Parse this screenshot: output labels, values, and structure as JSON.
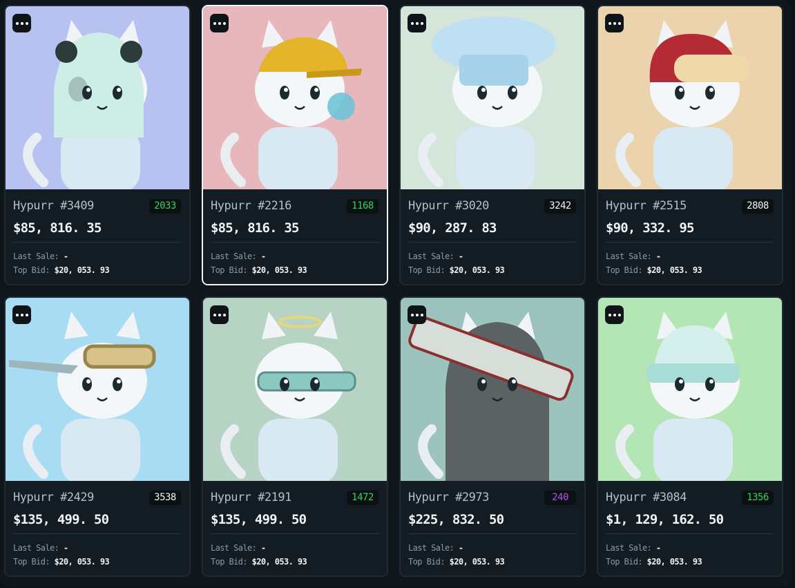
{
  "cards": [
    {
      "name": "Hypurr #3409",
      "rank": "2033",
      "rank_color": "#33d35c",
      "price": "$85, 816. 35",
      "last_sale_label": "Last Sale:",
      "last_sale_value": "-",
      "top_bid_label": "Top Bid:",
      "top_bid_value": "$20, 053. 93",
      "bg": "#b8c2f0",
      "accessory": "panda-hood",
      "selected": false
    },
    {
      "name": "Hypurr #2216",
      "rank": "1168",
      "rank_color": "#33d35c",
      "price": "$85, 816. 35",
      "last_sale_label": "Last Sale:",
      "last_sale_value": "-",
      "top_bid_label": "Top Bid:",
      "top_bid_value": "$20, 053. 93",
      "bg": "#e7b7bb",
      "accessory": "yellow-cap",
      "selected": true
    },
    {
      "name": "Hypurr #3020",
      "rank": "3242",
      "rank_color": "#f2f5f7",
      "price": "$90, 287. 83",
      "last_sale_label": "Last Sale:",
      "last_sale_value": "-",
      "top_bid_label": "Top Bid:",
      "top_bid_value": "$20, 053. 93",
      "bg": "#d4e5d9",
      "accessory": "chef-hat",
      "selected": false
    },
    {
      "name": "Hypurr #2515",
      "rank": "2808",
      "rank_color": "#f2f5f7",
      "price": "$90, 332. 95",
      "last_sale_label": "Last Sale:",
      "last_sale_value": "-",
      "top_bid_label": "Top Bid:",
      "top_bid_value": "$20, 053. 93",
      "bg": "#ead3ad",
      "accessory": "red-hat",
      "selected": false
    },
    {
      "name": "Hypurr #2429",
      "rank": "3538",
      "rank_color": "#f2f5f7",
      "price": "$135, 499. 50",
      "last_sale_label": "Last Sale:",
      "last_sale_value": "-",
      "top_bid_label": "Top Bid:",
      "top_bid_value": "$20, 053. 93",
      "bg": "#a8dcf3",
      "accessory": "goggles",
      "selected": false
    },
    {
      "name": "Hypurr #2191",
      "rank": "1472",
      "rank_color": "#33d35c",
      "price": "$135, 499. 50",
      "last_sale_label": "Last Sale:",
      "last_sale_value": "-",
      "top_bid_label": "Top Bid:",
      "top_bid_value": "$20, 053. 93",
      "bg": "#b7d3c3",
      "accessory": "halo",
      "selected": false
    },
    {
      "name": "Hypurr #2973",
      "rank": "240",
      "rank_color": "#b052f0",
      "price": "$225, 832. 50",
      "last_sale_label": "Last Sale:",
      "last_sale_value": "-",
      "top_bid_label": "Top Bid:",
      "top_bid_value": "$20, 053. 93",
      "bg": "#9cc3be",
      "accessory": "grey-hood",
      "selected": false
    },
    {
      "name": "Hypurr #3084",
      "rank": "1356",
      "rank_color": "#33d35c",
      "price": "$1, 129, 162. 50",
      "last_sale_label": "Last Sale:",
      "last_sale_value": "-",
      "top_bid_label": "Top Bid:",
      "top_bid_value": "$20, 053. 93",
      "bg": "#b3e6b4",
      "accessory": "beanie",
      "selected": false
    }
  ]
}
